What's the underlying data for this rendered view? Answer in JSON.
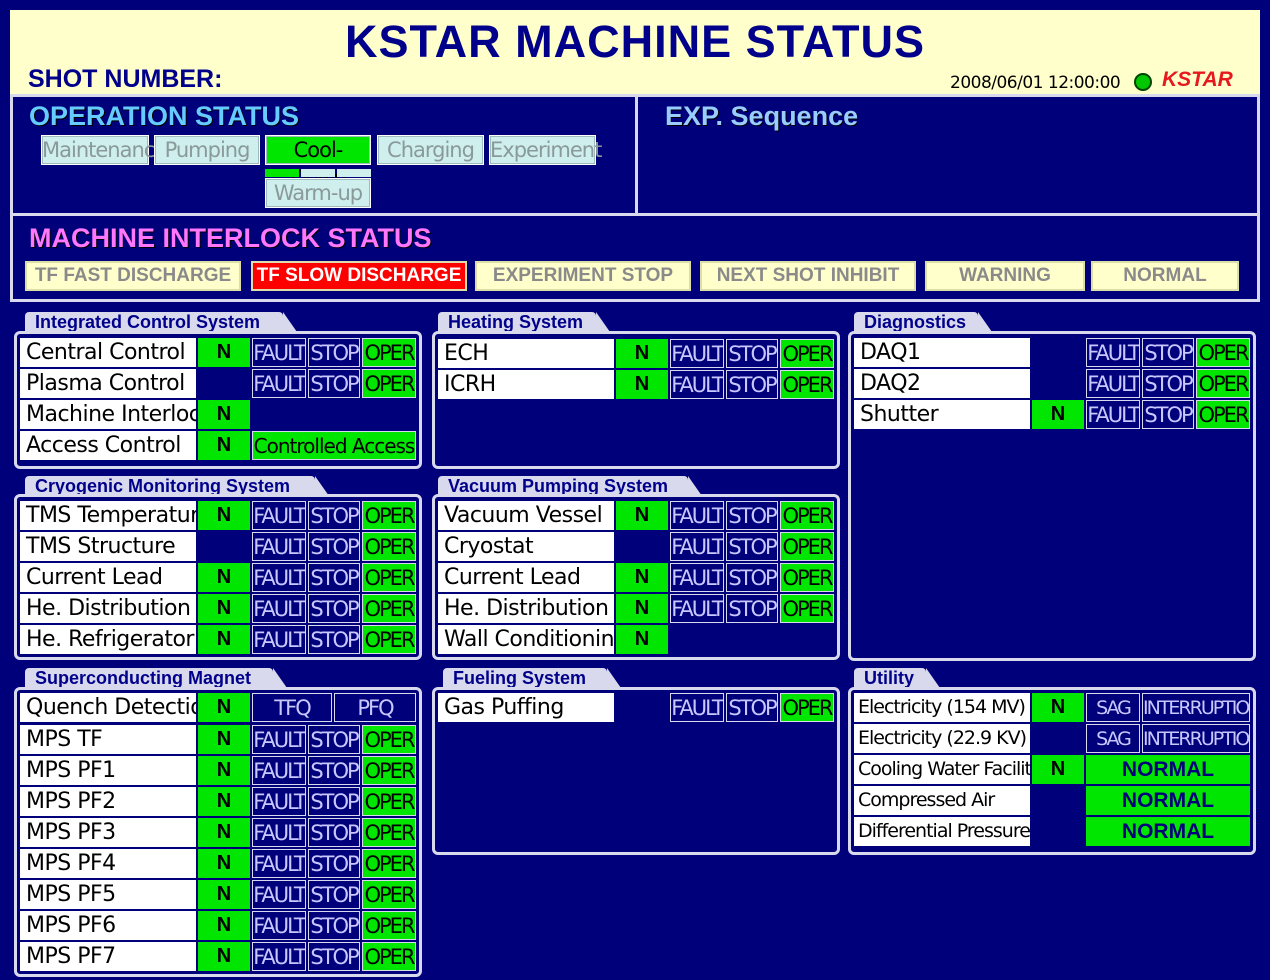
{
  "header": {
    "title": "KSTAR MACHINE STATUS",
    "shot_number_label": "SHOT NUMBER:",
    "datetime": "2008/06/01 12:00:00",
    "logo_text": "KSTAR",
    "led_color": "#00c800"
  },
  "operation": {
    "title": "OPERATION STATUS",
    "modes": [
      "Maintenance",
      "Pumping",
      "Cool-Down",
      "Charging",
      "Experiment",
      "Warm-up"
    ],
    "active_mode": "Cool-Down",
    "cooldown_progress_segments_on": 1,
    "cooldown_progress_segments_total": 3
  },
  "exp_sequence": {
    "title": "EXP. Sequence"
  },
  "interlock": {
    "title": "MACHINE INTERLOCK STATUS",
    "items": [
      "TF FAST DISCHARGE",
      "TF SLOW DISCHARGE",
      "EXPERIMENT STOP",
      "NEXT SHOT INHIBIT",
      "WARNING",
      "NORMAL"
    ],
    "active": "TF SLOW DISCHARGE"
  },
  "labels": {
    "n": "N",
    "fault": "FAULT",
    "stop": "STOP",
    "oper": "OPER",
    "controlled_access": "Controlled Access",
    "tfq": "TFQ",
    "pfq": "PFQ",
    "sag": "SAG",
    "interruption": "INTERRUPTION",
    "normal": "NORMAL"
  },
  "ics": {
    "title": "Integrated Control System",
    "rows": [
      "Central Control",
      "Plasma Control",
      "Machine Interlock",
      "Access Control"
    ]
  },
  "heating": {
    "title": "Heating System",
    "rows": [
      "ECH",
      "ICRH"
    ]
  },
  "diagnostics": {
    "title": "Diagnostics",
    "rows": [
      "DAQ1",
      "DAQ2",
      "Shutter"
    ]
  },
  "cryo": {
    "title": "Cryogenic Monitoring System",
    "rows": [
      "TMS Temperature",
      "TMS Structure",
      "Current Lead",
      "He. Distribution",
      "He. Refrigerator"
    ]
  },
  "vacuum": {
    "title": "Vacuum Pumping System",
    "rows": [
      "Vacuum Vessel",
      "Cryostat",
      "Current Lead",
      "He. Distribution",
      "Wall Conditioning"
    ]
  },
  "magnet": {
    "title": "Superconducting Magnet",
    "rows": [
      "Quench Detection",
      "MPS TF",
      "MPS PF1",
      "MPS PF2",
      "MPS PF3",
      "MPS PF4",
      "MPS PF5",
      "MPS PF6",
      "MPS PF7"
    ]
  },
  "fueling": {
    "title": "Fueling System",
    "rows": [
      "Gas Puffing"
    ]
  },
  "utility": {
    "title": "Utility",
    "rows": [
      "Electricity (154 MV)",
      "Electricity (22.9 KV)",
      "Cooling Water Facility",
      "Compressed Air",
      "Differential Pressure"
    ]
  },
  "colors": {
    "background": "#00007b",
    "header_bg": "#ffffcc",
    "on_green": "#00e600",
    "alarm_red": "#ff0000",
    "title_cyan": "#66ccff",
    "title_pink": "#ff77ff"
  }
}
